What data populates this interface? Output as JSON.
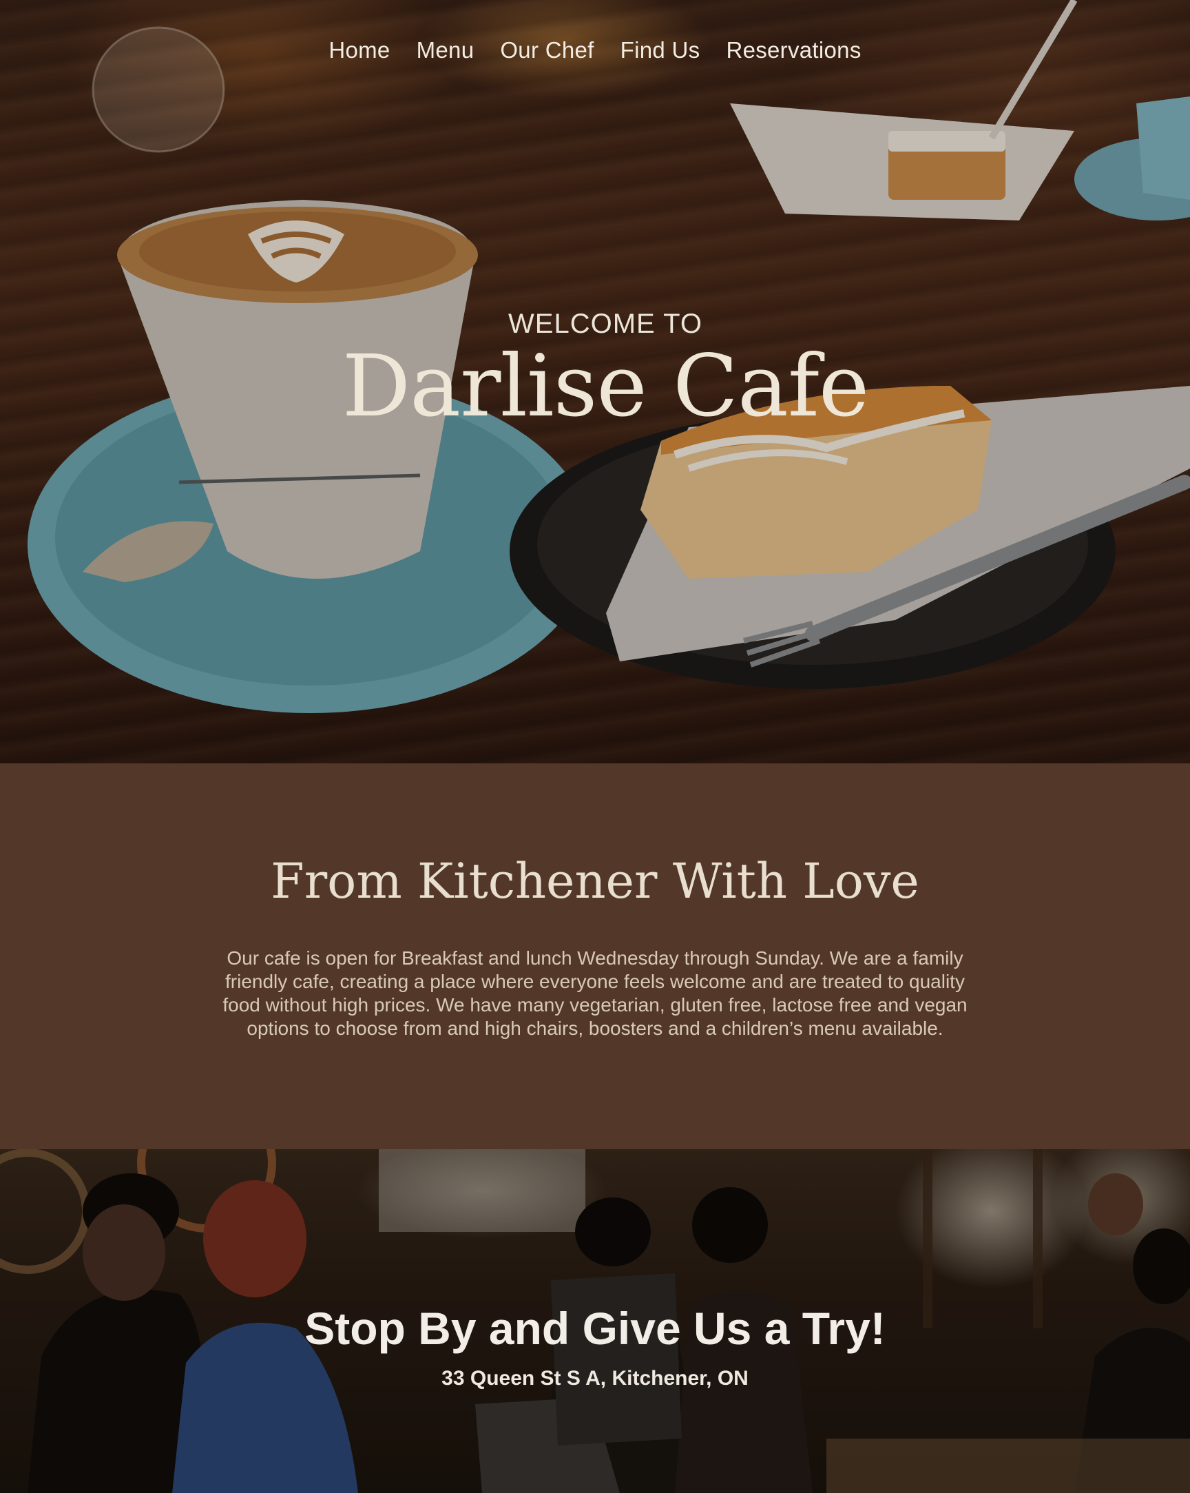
{
  "nav": {
    "items": [
      {
        "label": "Home"
      },
      {
        "label": "Menu"
      },
      {
        "label": "Our Chef"
      },
      {
        "label": "Find Us"
      },
      {
        "label": "Reservations"
      }
    ]
  },
  "hero": {
    "kicker": "WELCOME TO",
    "title": "Darlise Cafe"
  },
  "about": {
    "heading": "From Kitchener With Love",
    "body": "Our cafe is open for Breakfast and lunch Wednesday through Sunday. We are a family friendly cafe, creating a place where everyone feels welcome and are treated to quality food without high prices.  We have many vegetarian, gluten free, lactose free and vegan options to choose from and  high chairs, boosters and a children’s menu available."
  },
  "visit": {
    "heading": "Stop By and Give Us a Try!",
    "address": "33 Queen St S A, Kitchener, ON"
  },
  "colors": {
    "section_brown": "#533829",
    "text_cream": "#f1ebe1"
  }
}
